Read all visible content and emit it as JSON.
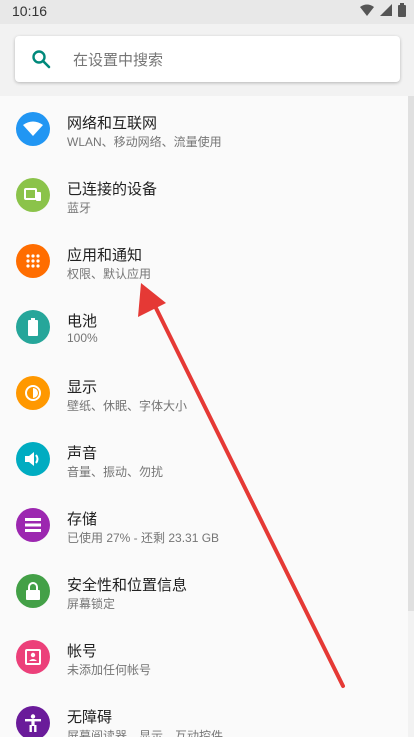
{
  "status_bar": {
    "time": "10:16"
  },
  "search": {
    "placeholder": "在设置中搜索"
  },
  "settings": [
    {
      "title": "网络和互联网",
      "subtitle": "WLAN、移动网络、流量使用",
      "icon": "wifi-icon",
      "color": "#2196f3"
    },
    {
      "title": "已连接的设备",
      "subtitle": "蓝牙",
      "icon": "devices-icon",
      "color": "#8bc34a"
    },
    {
      "title": "应用和通知",
      "subtitle": "权限、默认应用",
      "icon": "apps-icon",
      "color": "#ff6d00"
    },
    {
      "title": "电池",
      "subtitle": "100%",
      "icon": "battery-icon",
      "color": "#26a69a"
    },
    {
      "title": "显示",
      "subtitle": "壁纸、休眠、字体大小",
      "icon": "display-icon",
      "color": "#ff9800"
    },
    {
      "title": "声音",
      "subtitle": "音量、振动、勿扰",
      "icon": "sound-icon",
      "color": "#00acc1"
    },
    {
      "title": "存储",
      "subtitle": "已使用 27% - 还剩 23.31 GB",
      "icon": "storage-icon",
      "color": "#9c27b0"
    },
    {
      "title": "安全性和位置信息",
      "subtitle": "屏幕锁定",
      "icon": "lock-icon",
      "color": "#43a047"
    },
    {
      "title": "帐号",
      "subtitle": "未添加任何帐号",
      "icon": "account-icon",
      "color": "#ec407a"
    },
    {
      "title": "无障碍",
      "subtitle": "屏幕阅读器、显示、互动控件",
      "icon": "accessibility-icon",
      "color": "#6a1b9a"
    }
  ],
  "colors": {
    "accent": "#00897b",
    "annotation_arrow": "#e53935"
  }
}
